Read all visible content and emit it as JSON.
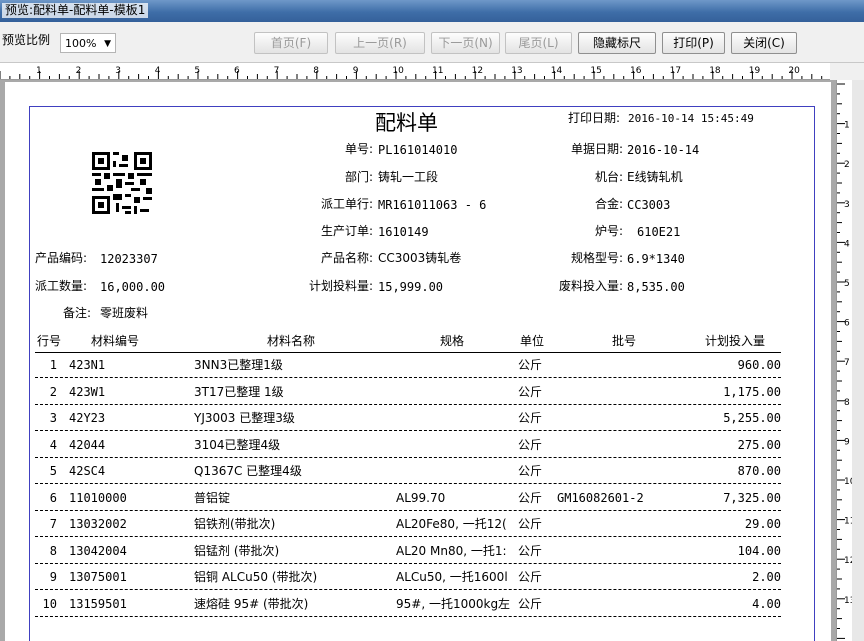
{
  "window": {
    "title": "预览:配料单-配料单-模板1"
  },
  "toolbar": {
    "zoom_label": "预览比例",
    "zoom_value": "100%",
    "first_label": "首页(F)",
    "prev_label": "上一页(R)",
    "next_label": "下一页(N)",
    "last_label": "尾页(L)",
    "hide_marks_label": "隐藏标尺",
    "print_label": "打印(P)",
    "close_label": "关闭(C)"
  },
  "ruler": {
    "labels": [
      "1",
      "2",
      "3",
      "4",
      "5",
      "6",
      "7",
      "8",
      "9",
      "10",
      "11",
      "12",
      "13",
      "14",
      "15",
      "16",
      "17",
      "18",
      "19",
      "20"
    ]
  },
  "vruler": {
    "labels": [
      "1",
      "2",
      "3",
      "4",
      "5",
      "6",
      "7",
      "8",
      "9",
      "10",
      "11",
      "12",
      "13"
    ]
  },
  "report": {
    "title": "配料单",
    "print_date_label": "打印日期:",
    "print_date_value": "2016-10-14 15:45:49",
    "order_no_label": "单号:",
    "order_no_value": "PL161014010",
    "doc_date_label": "单据日期:",
    "doc_date_value": "2016-10-14",
    "dept_label": "部门:",
    "dept_value": "铸轧一工段",
    "machine_label": "机台:",
    "machine_value": "E线铸轧机",
    "dispatch_label": "派工单行:",
    "dispatch_value": "MR161011063 - 6",
    "alloy_label": "合金:",
    "alloy_value": "CC3003",
    "production_order_label": "生产订单:",
    "production_order_value": "1610149",
    "furnace_label": "炉号:",
    "furnace_value": "610E21",
    "product_code_label": "产品编码:",
    "product_code_value": "12023307",
    "product_name_label": "产品名称:",
    "product_name_value": "CC3003铸轧卷",
    "spec_label": "规格型号:",
    "spec_value": "6.9*1340",
    "dispatch_qty_label": "派工数量:",
    "dispatch_qty_value": "16,000.00",
    "planned_qty_label": "计划投料量:",
    "planned_qty_value": "15,999.00",
    "scrap_qty_label": "废料投入量:",
    "scrap_qty_value": "8,535.00",
    "remark_label": "备注:",
    "remark_value": "零班废料"
  },
  "table": {
    "headers": {
      "line": "行号",
      "code": "材料编号",
      "name": "材料名称",
      "spec": "规格",
      "unit": "单位",
      "batch": "批号",
      "qty": "计划投入量"
    },
    "rows": [
      {
        "line": "1",
        "code": "423N1",
        "name": "3NN3已整理1级",
        "spec": "",
        "unit": "公斤",
        "batch": "",
        "qty": "960.00"
      },
      {
        "line": "2",
        "code": "423W1",
        "name": "3T17已整理 1级",
        "spec": "",
        "unit": "公斤",
        "batch": "",
        "qty": "1,175.00"
      },
      {
        "line": "3",
        "code": "42Y23",
        "name": "YJ3003 已整理3级",
        "spec": "",
        "unit": "公斤",
        "batch": "",
        "qty": "5,255.00"
      },
      {
        "line": "4",
        "code": "42044",
        "name": "3104已整理4级",
        "spec": "",
        "unit": "公斤",
        "batch": "",
        "qty": "275.00"
      },
      {
        "line": "5",
        "code": "42SC4",
        "name": "Q1367C 已整理4级",
        "spec": "",
        "unit": "公斤",
        "batch": "",
        "qty": "870.00"
      },
      {
        "line": "6",
        "code": "11010000",
        "name": "普铝锭",
        "spec": "AL99.70",
        "unit": "公斤",
        "batch": "GM16082601-2",
        "qty": "7,325.00"
      },
      {
        "line": "7",
        "code": "13032002",
        "name": "铝铁剂(带批次)",
        "spec": "AL20Fe80, 一托12(",
        "unit": "公斤",
        "batch": "",
        "qty": "29.00"
      },
      {
        "line": "8",
        "code": "13042004",
        "name": "铝锰剂 (带批次)",
        "spec": "AL20 Mn80, 一托1:",
        "unit": "公斤",
        "batch": "",
        "qty": "104.00"
      },
      {
        "line": "9",
        "code": "13075001",
        "name": "铝铜 ALCu50 (带批次)",
        "spec": "ALCu50, 一托1600l",
        "unit": "公斤",
        "batch": "",
        "qty": "2.00"
      },
      {
        "line": "10",
        "code": "13159501",
        "name": "速熔硅 95# (带批次)",
        "spec": "95#, 一托1000kg左",
        "unit": "公斤",
        "batch": "",
        "qty": "4.00"
      }
    ]
  }
}
